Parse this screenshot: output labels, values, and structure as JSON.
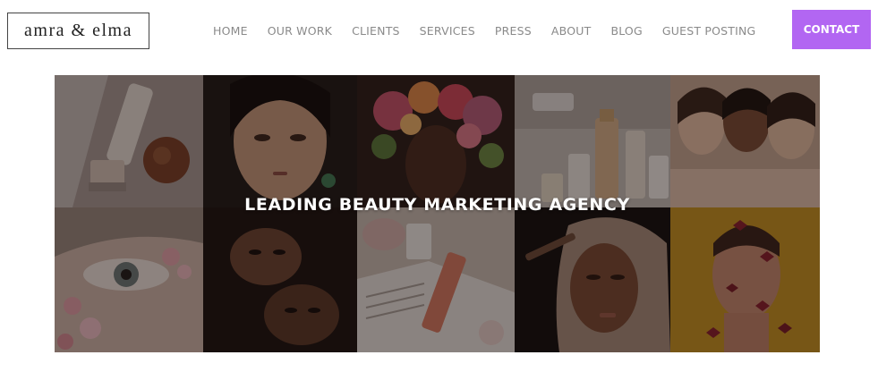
{
  "header": {
    "logo_text": "amra & elma",
    "nav": [
      {
        "id": "home",
        "label": "HOME"
      },
      {
        "id": "our-work",
        "label": "OUR WORK"
      },
      {
        "id": "clients",
        "label": "CLIENTS"
      },
      {
        "id": "services",
        "label": "SERVICES"
      },
      {
        "id": "press",
        "label": "PRESS"
      },
      {
        "id": "about",
        "label": "ABOUT"
      },
      {
        "id": "blog",
        "label": "BLOG"
      },
      {
        "id": "guest-posting",
        "label": "GUEST POSTING"
      }
    ],
    "contact_label": "CONTACT"
  },
  "hero": {
    "title": "LEADING BEAUTY MARKETING AGENCY"
  },
  "colors": {
    "accent": "#b266f2",
    "nav_text": "#8a8a8a",
    "logo_border": "#444444"
  }
}
